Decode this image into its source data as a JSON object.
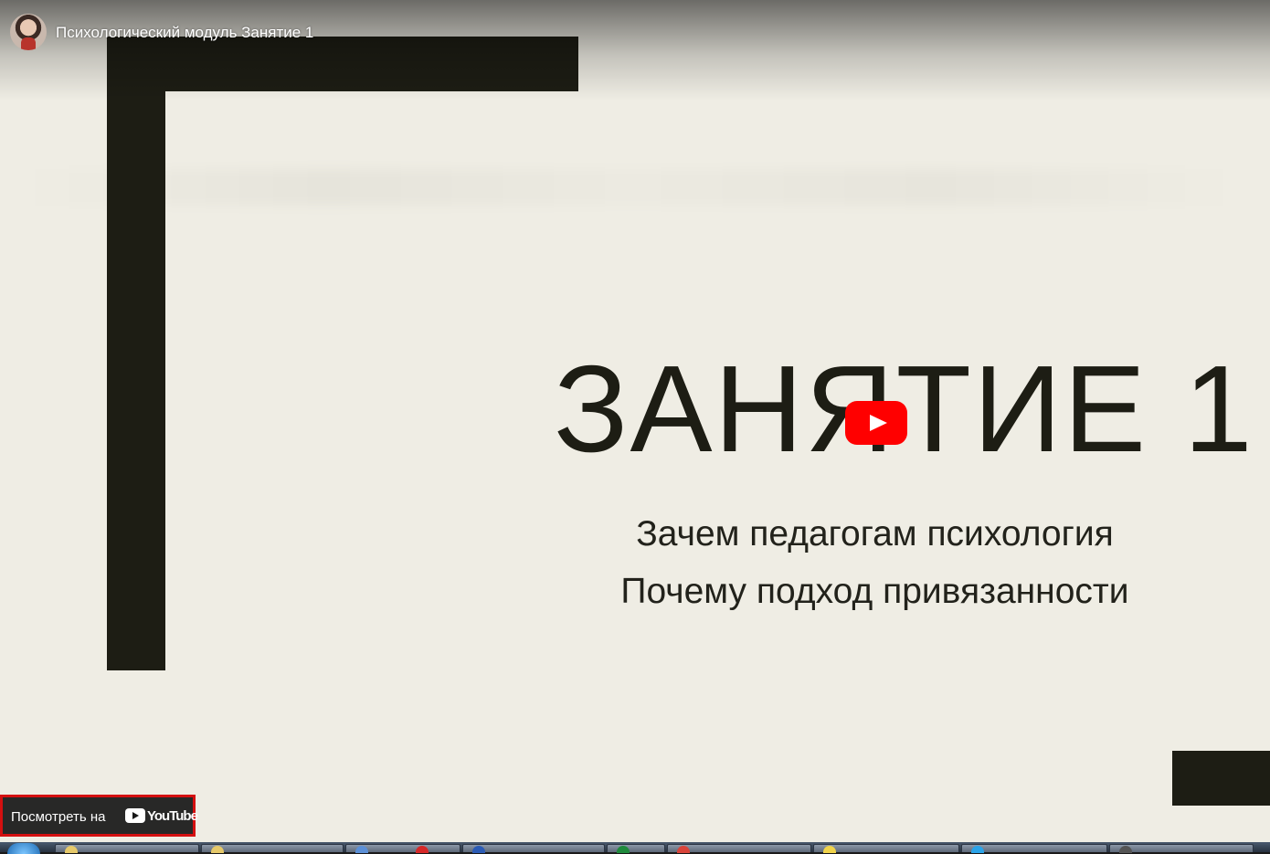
{
  "player": {
    "video_title": "Психологический модуль Занятие 1",
    "avatar_icon": "channel-avatar-icon",
    "play_icon": "play-icon",
    "accent_color": "#ff0000"
  },
  "slide": {
    "heading": "ЗАНЯТИЕ 1",
    "line1": "Зачем педагогам психология",
    "line2": "Почему подход привязанности"
  },
  "watch_on": {
    "label": "Посмотреть на",
    "brand": "YouTube",
    "icon": "youtube-logo-icon",
    "border_color": "#d41010"
  },
  "taskbar": {
    "start_icon": "windows-start-icon",
    "items": [
      {
        "icon": "folder-icon"
      },
      {
        "icon": "folder-icon"
      },
      {
        "icon": "document-icon"
      },
      {
        "icon": "opera-icon"
      },
      {
        "icon": "word-icon"
      },
      {
        "icon": "excel-icon"
      },
      {
        "icon": "chrome-icon"
      },
      {
        "icon": "paint-icon"
      },
      {
        "icon": "skype-icon"
      },
      {
        "icon": "app-icon"
      }
    ]
  }
}
